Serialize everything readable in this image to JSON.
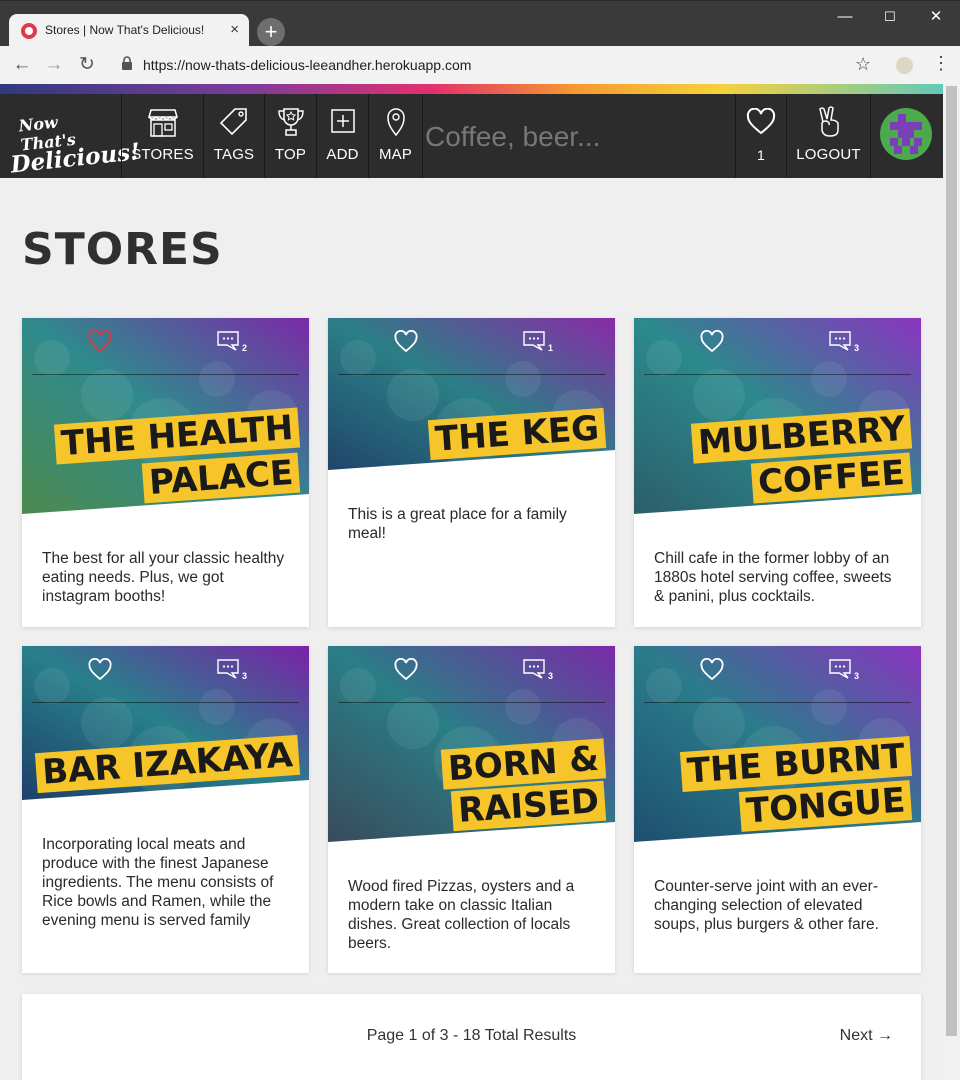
{
  "browser": {
    "tab_title": "Stores | Now That's Delicious!",
    "tab_close": "×",
    "new_tab": "+",
    "url": "https://now-thats-delicious-leeandher.herokuapp.com",
    "back": "←",
    "forward": "→",
    "reload": "↻",
    "bookmark": "☆",
    "menu": "⋮",
    "minimize": "—",
    "maximize": "☐",
    "close": "✕"
  },
  "site": {
    "logo_line1": "Now That's",
    "logo_line2": "Delicious!",
    "nav": [
      {
        "label": "STORES",
        "icon": "store-icon"
      },
      {
        "label": "TAGS",
        "icon": "tag-icon"
      },
      {
        "label": "TOP",
        "icon": "trophy-icon"
      },
      {
        "label": "ADD",
        "icon": "add-icon"
      },
      {
        "label": "MAP",
        "icon": "map-pin-icon"
      }
    ],
    "search_placeholder": "Coffee, beer...",
    "hearts_count": "1",
    "logout_label": "LOGOUT"
  },
  "page": {
    "title": "STORES"
  },
  "stores": [
    {
      "title_lines": [
        "THE HEALTH",
        "PALACE"
      ],
      "description": "The best for all your classic healthy eating needs. Plus, we got instagram booths!",
      "comments": "2",
      "hearted": true
    },
    {
      "title_lines": [
        "THE KEG"
      ],
      "description": "This is a great place for a family meal!",
      "comments": "1",
      "hearted": false
    },
    {
      "title_lines": [
        "MULBERRY",
        "COFFEE"
      ],
      "description": "Chill cafe in the former lobby of an 1880s hotel serving coffee, sweets & panini, plus cocktails.",
      "comments": "3",
      "hearted": false
    },
    {
      "title_lines": [
        "BAR IZAKAYA"
      ],
      "description": "Incorporating local meats and produce with the finest Japanese ingredients. The menu consists of Rice bowls and Ramen, while the evening menu is served family",
      "comments": "3",
      "hearted": false
    },
    {
      "title_lines": [
        "BORN &",
        "RAISED"
      ],
      "description": "Wood fired Pizzas, oysters and a modern take on classic Italian dishes. Great collection of locals beers.",
      "comments": "3",
      "hearted": false
    },
    {
      "title_lines": [
        "THE BURNT",
        "TONGUE"
      ],
      "description": "Counter-serve joint with an ever-changing selection of elevated soups, plus burgers & other fare.",
      "comments": "3",
      "hearted": false
    }
  ],
  "pagination": {
    "text": "Page 1 of 3 - 18 Total Results",
    "next_label": "Next →"
  },
  "colors": {
    "nav_bg": "#2c2c2c",
    "title_highlight": "#f6c52a",
    "heart_active": "#e0393e",
    "page_bg": "#efefef"
  }
}
